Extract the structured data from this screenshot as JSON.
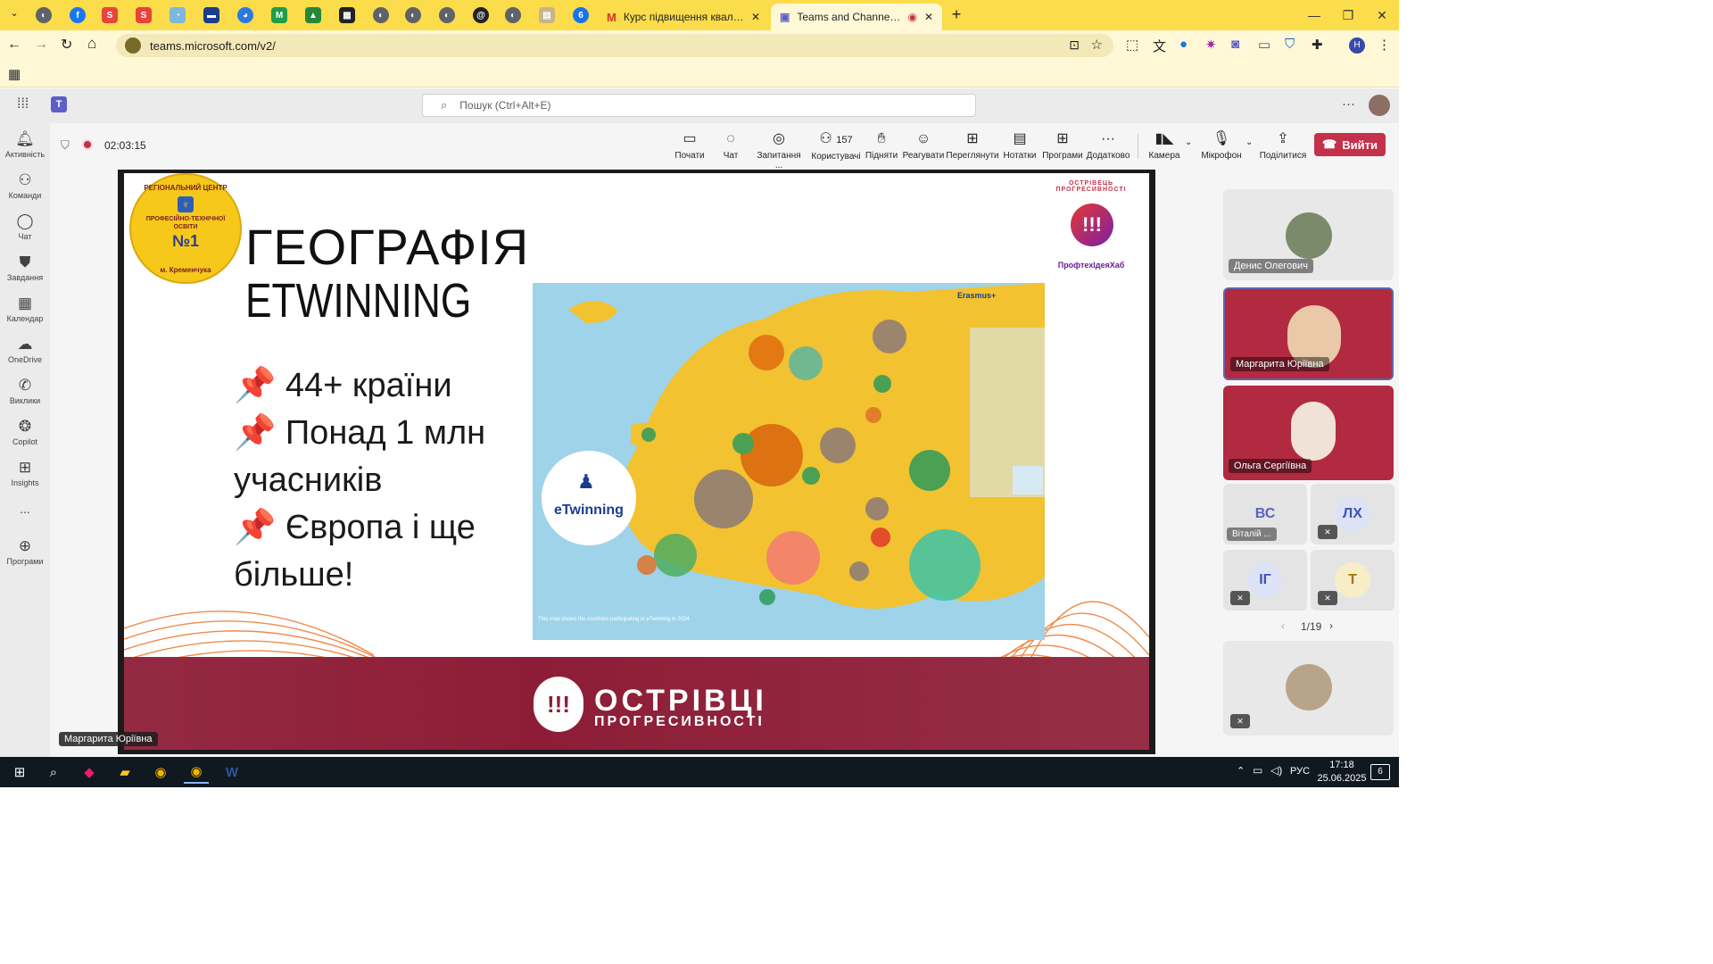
{
  "browser": {
    "tabs": [
      {
        "title": "Курс підвищення кваліфікації",
        "favicon": "gmail-icon"
      },
      {
        "title": "Teams and Channels | Курс",
        "favicon": "teams-icon",
        "active": true
      }
    ],
    "new_tab": "+",
    "url": "teams.microsoft.com/v2/",
    "profile_initial": "H"
  },
  "teams": {
    "search_placeholder": "Пошук (Ctrl+Alt+E)",
    "rail": [
      {
        "label": "Активність",
        "icon": "bell-icon"
      },
      {
        "label": "Команди",
        "icon": "teams-icon"
      },
      {
        "label": "Чат",
        "icon": "chat-icon"
      },
      {
        "label": "Завдання",
        "icon": "assignments-icon"
      },
      {
        "label": "Календар",
        "icon": "calendar-icon"
      },
      {
        "label": "OneDrive",
        "icon": "cloud-icon"
      },
      {
        "label": "Виклики",
        "icon": "phone-icon"
      },
      {
        "label": "Copilot",
        "icon": "copilot-icon"
      },
      {
        "label": "Insights",
        "icon": "insights-icon"
      },
      {
        "label": "...",
        "icon": "more-icon"
      },
      {
        "label": "Програми",
        "icon": "add-apps-icon"
      }
    ],
    "meeting": {
      "timer": "02:03:15",
      "toolbar": [
        {
          "label": "Почати",
          "icon": "start-icon"
        },
        {
          "label": "Чат",
          "icon": "chat-icon"
        },
        {
          "label": "Запитання ...",
          "icon": "qa-icon"
        },
        {
          "label": "Користувачі",
          "icon": "people-icon",
          "count": "157"
        },
        {
          "label": "Підняти",
          "icon": "raise-hand-icon"
        },
        {
          "label": "Реагувати",
          "icon": "react-icon"
        },
        {
          "label": "Переглянути",
          "icon": "view-icon"
        },
        {
          "label": "Нотатки",
          "icon": "notes-icon"
        },
        {
          "label": "Програми",
          "icon": "apps-icon"
        },
        {
          "label": "Додатково",
          "icon": "more-icon"
        },
        {
          "label": "Камера",
          "icon": "camera-off-icon"
        },
        {
          "label": "Мікрофон",
          "icon": "mic-off-icon"
        },
        {
          "label": "Поділитися",
          "icon": "share-icon"
        }
      ],
      "leave_label": "Вийти",
      "presenter_label": "Маргарита Юріївна",
      "slide": {
        "badge_arc": "РЕГІОНАЛЬНИЙ ЦЕНТР",
        "badge_line1": "ПРОФЕСІЙНО-ТЕХНІЧНОЇ",
        "badge_line2": "ОСВІТИ",
        "badge_num": "№1",
        "badge_city": "м. Кременчука",
        "title1": "ГЕОГРАФІЯ",
        "title2": "ETWINNING",
        "bullets": [
          "📌 44+ країни",
          "📌 Понад 1 млн учасників",
          "📌 Європа і ще більше!"
        ],
        "right_logo_caption": "ПрофтехІдеяХаб",
        "right_logo_arc": "ОСТРІВЕЦЬ ПРОГРЕСИВНОСТІ",
        "etwinning_logo": "eTwinning",
        "erasmus": "Erasmus+",
        "map_caption": "This map shows the countries participating in eTwinning in 2024",
        "bottom_brand1": "ОСТРІВЦІ",
        "bottom_brand2": "ПРОГРЕСИВНОСТІ"
      },
      "participants": [
        {
          "name": "Денис Олегович"
        },
        {
          "name": "Маргарита Юріївна"
        },
        {
          "name": "Ольга Сергіївна"
        },
        {
          "name": "Віталій ...",
          "initials": "ВС"
        },
        {
          "initials": "ЛХ"
        },
        {
          "initials": "ІГ"
        },
        {
          "initials": "Т"
        }
      ],
      "pager": "1/19"
    }
  },
  "taskbar": {
    "lang": "РУС",
    "time": "17:18",
    "date": "25.06.2025",
    "notifications": "6"
  }
}
